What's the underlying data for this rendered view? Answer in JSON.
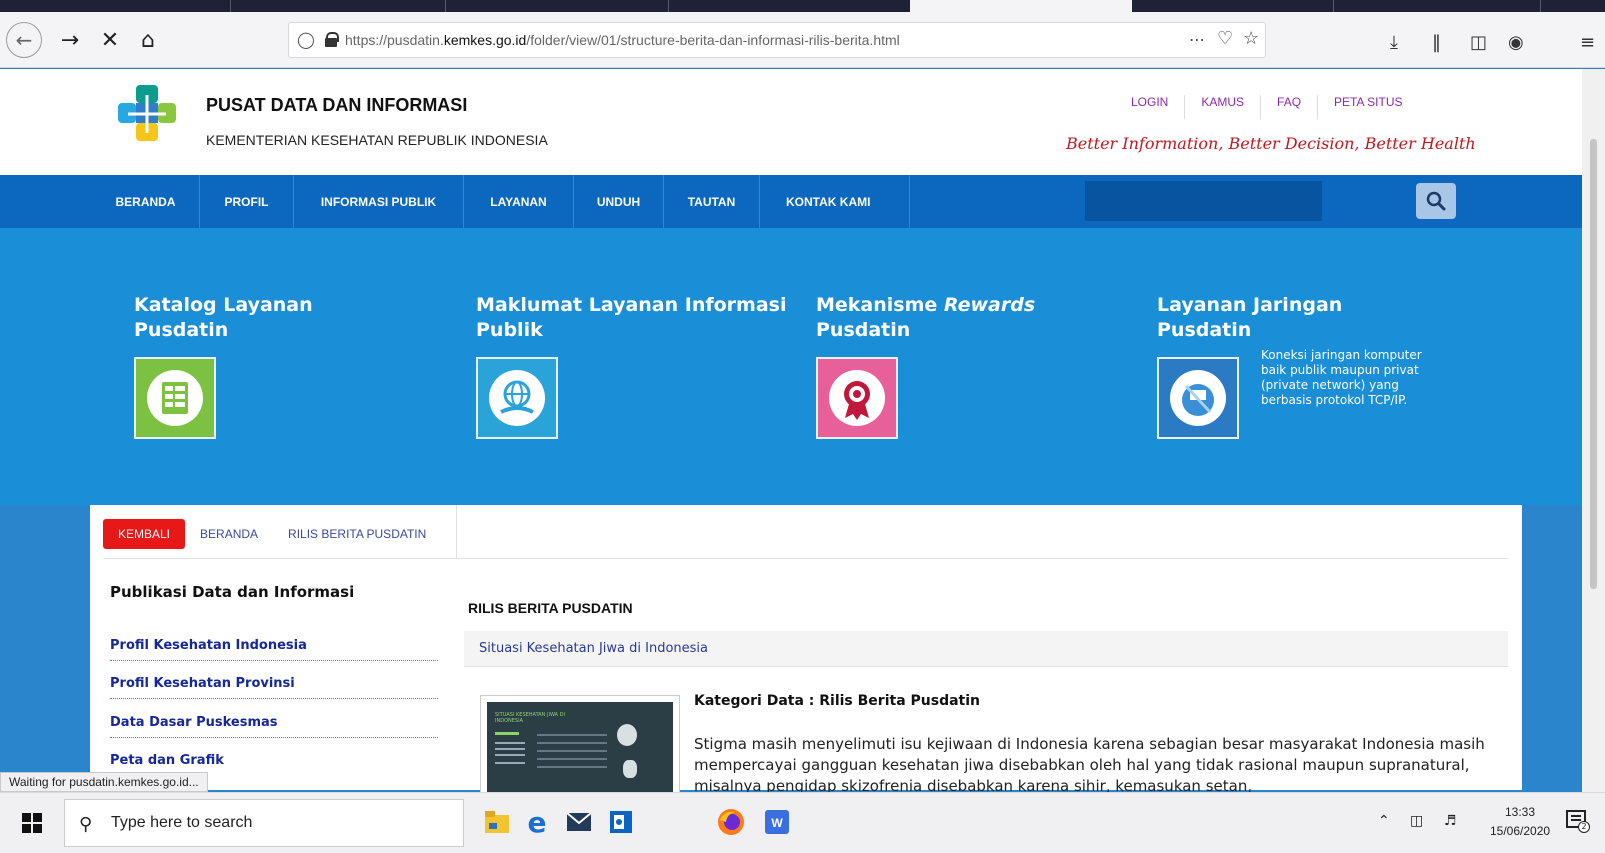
{
  "browser": {
    "url_prefix": "https://pusdatin.",
    "url_domain": "kemkes.go.id",
    "url_path": "/folder/view/01/structure-berita-dan-informasi-rilis-berita.html",
    "status_text": "Waiting for pusdatin.kemkes.go.id..."
  },
  "header": {
    "title": "PUSAT DATA DAN INFORMASI",
    "subtitle": "KEMENTERIAN KESEHATAN REPUBLIK INDONESIA",
    "links": [
      "LOGIN",
      "KAMUS",
      "FAQ",
      "PETA SITUS"
    ],
    "tagline": "Better Information, Better Decision, Better Health"
  },
  "nav": {
    "items": [
      "BERANDA",
      "PROFIL",
      "INFORMASI PUBLIK",
      "LAYANAN",
      "UNDUH",
      "TAUTAN",
      "KONTAK KAMI"
    ]
  },
  "hero": {
    "cards": [
      {
        "line1": "Katalog Layanan",
        "line2": "Pusdatin"
      },
      {
        "line1": "Maklumat Layanan Informasi",
        "line2": "Publik"
      },
      {
        "line1": "Mekanisme ",
        "line1_italic": "Rewards",
        "line2": "Pusdatin"
      },
      {
        "line1": "Layanan Jaringan",
        "line2": "Pusdatin"
      }
    ],
    "jaringan_desc": "Koneksi jaringan komputer baik publik maupun privat (private network) yang berbasis protokol TCP/IP."
  },
  "tabs": {
    "back": "KEMBALI",
    "home": "BERANDA",
    "current": "RILIS BERITA PUSDATIN"
  },
  "sidebar": {
    "title": "Publikasi Data dan Informasi",
    "items": [
      "Profil Kesehatan Indonesia",
      "Profil Kesehatan Provinsi",
      "Data Dasar Puskesmas",
      "Peta dan Grafik"
    ]
  },
  "main": {
    "title": "RILIS BERITA PUSDATIN",
    "article_title": "Situasi Kesehatan Jiwa di Indonesia",
    "category": "Kategori Data : Rilis Berita Pusdatin",
    "description": "Stigma masih menyelimuti isu kejiwaan di Indonesia karena sebagian besar masyarakat Indonesia masih mempercayai  gangguan kesehatan jiwa disebabkan oleh hal yang tidak rasional maupun supranatural, misalnya pengidap skizofrenia disebabkan karena sihir, kemasukan setan,",
    "thumb_title": "SITUASI KESEHATAN JIWA DI INDONESIA"
  },
  "taskbar": {
    "search_placeholder": "Type here to search",
    "time": "13:33",
    "date": "15/06/2020",
    "notification_count": "2"
  },
  "colors": {
    "nav_blue": "#0c67bf",
    "hero_blue": "#1a8fd8",
    "accent_red": "#e71818",
    "tagline_red": "#c0181e",
    "link_blue": "#15279a"
  }
}
